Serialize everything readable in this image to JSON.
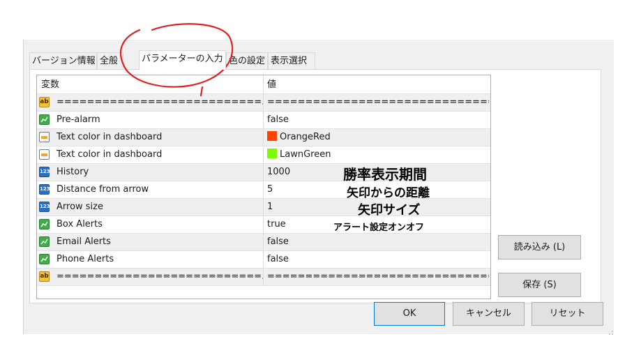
{
  "tabs": [
    {
      "label": "バージョン情報",
      "active": false
    },
    {
      "label": "全般",
      "active": false
    },
    {
      "label": "パラメーターの入力",
      "active": true
    },
    {
      "label": "色の設定",
      "active": false
    },
    {
      "label": "表示選択",
      "active": false
    }
  ],
  "grid": {
    "header": {
      "name": "変数",
      "value": "値"
    },
    "rows": [
      {
        "icon": "ab-string-icon",
        "name": "===========================...",
        "value": "===============================..."
      },
      {
        "icon": "chart-bool-icon",
        "name": "Pre-alarm",
        "value": "false"
      },
      {
        "icon": "color-icon",
        "name": "Text color in dashboard",
        "value": "OrangeRed",
        "swatch": "#ff4500"
      },
      {
        "icon": "color-icon",
        "name": "Text color in dashboard",
        "value": "LawnGreen",
        "swatch": "#7cfc00"
      },
      {
        "icon": "number-icon",
        "name": "History",
        "value": "1000"
      },
      {
        "icon": "number-icon",
        "name": "Distance from arrow",
        "value": "5"
      },
      {
        "icon": "number-icon",
        "name": "Arrow size",
        "value": "1"
      },
      {
        "icon": "chart-bool-icon",
        "name": "Box Alerts",
        "value": "true"
      },
      {
        "icon": "chart-bool-icon",
        "name": "Email Alerts",
        "value": "false"
      },
      {
        "icon": "chart-bool-icon",
        "name": "Phone Alerts",
        "value": "false"
      },
      {
        "icon": "ab-string-icon",
        "name": "===========================...",
        "value": "===============================..."
      }
    ]
  },
  "annotations": {
    "history": "勝率表示期間",
    "distance": "矢印からの距離",
    "arrow_size": "矢印サイズ",
    "box_alerts": "アラート設定オンオフ"
  },
  "buttons": {
    "load": "読み込み (L)",
    "save": "保存 (S)",
    "ok": "OK",
    "cancel": "キャンセル",
    "reset": "リセット"
  },
  "colors": {
    "highlight_circle": "#e02020",
    "default_button_border": "#0078d7"
  }
}
